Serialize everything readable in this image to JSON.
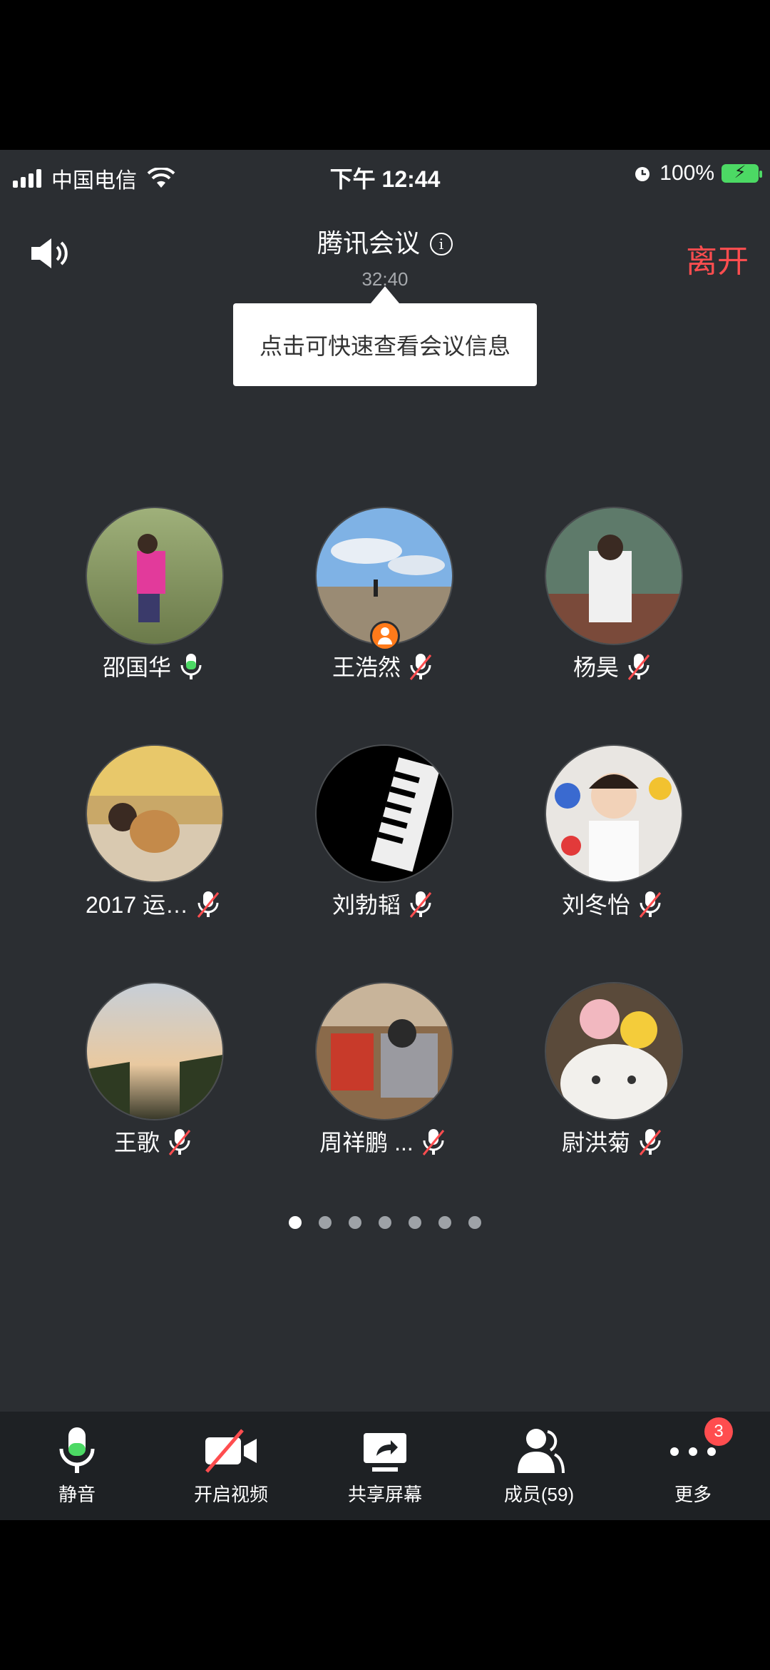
{
  "status_bar": {
    "carrier": "中国电信",
    "time": "下午 12:44",
    "battery": "100%"
  },
  "header": {
    "title": "腾讯会议",
    "duration": "32:40",
    "leave_label": "离开"
  },
  "tooltip": "点击可快速查看会议信息",
  "participants": [
    {
      "name": "邵国华",
      "mic": "on",
      "host": false
    },
    {
      "name": "王浩然",
      "mic": "muted",
      "host": true
    },
    {
      "name": "杨昊",
      "mic": "muted",
      "host": false
    },
    {
      "name": "2017 运…",
      "mic": "muted",
      "host": false
    },
    {
      "name": "刘勃韬",
      "mic": "muted",
      "host": false
    },
    {
      "name": "刘冬怡",
      "mic": "muted",
      "host": false
    },
    {
      "name": "王歌",
      "mic": "muted",
      "host": false
    },
    {
      "name": "周祥鹏 ...",
      "mic": "muted",
      "host": false
    },
    {
      "name": "尉洪菊",
      "mic": "muted",
      "host": false
    }
  ],
  "pagination": {
    "pages": 7,
    "current": 1
  },
  "toolbar": {
    "mute_label": "静音",
    "video_label": "开启视频",
    "share_label": "共享屏幕",
    "members_label": "成员(59)",
    "more_label": "更多",
    "more_badge": "3"
  },
  "colors": {
    "background": "#2b2e32",
    "toolbar": "#1e2124",
    "leave": "#ff4d4f",
    "mic_on": "#4cd964",
    "host_badge": "#ff7a1a"
  }
}
